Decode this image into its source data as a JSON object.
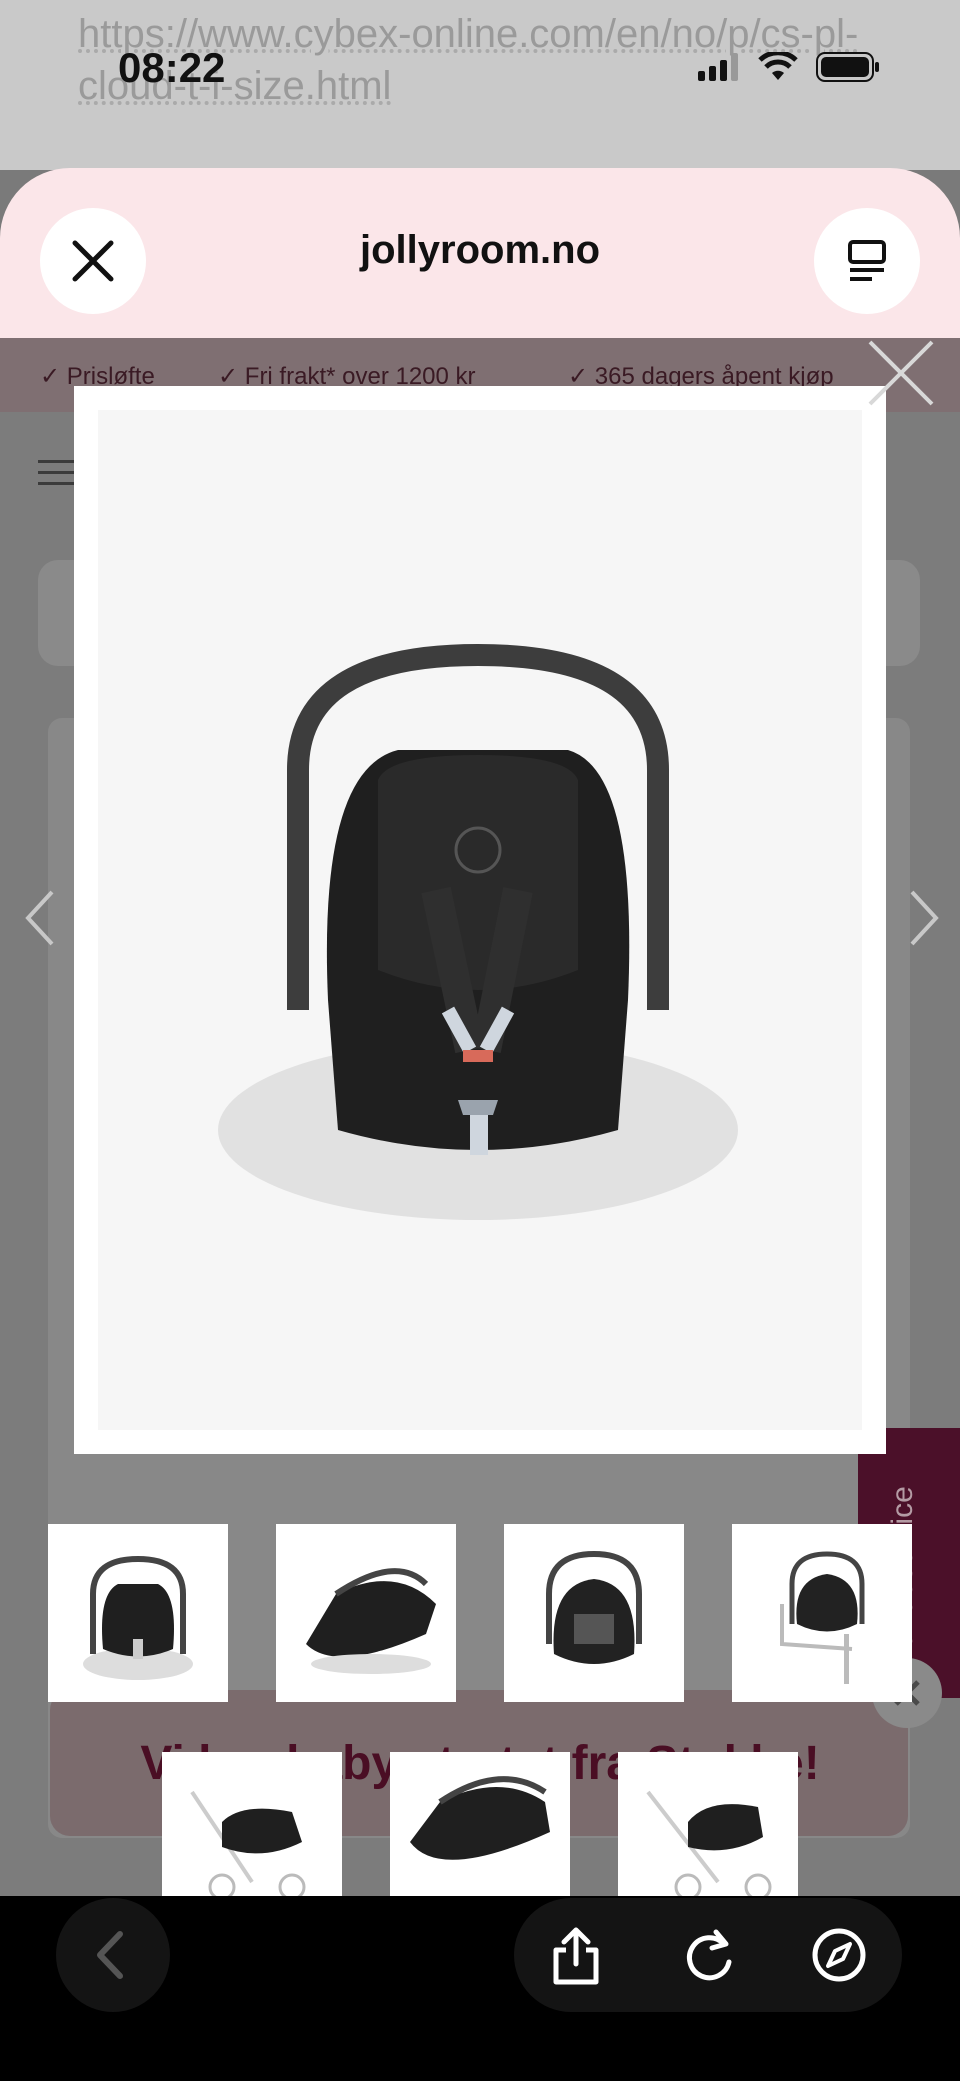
{
  "browser": {
    "url_text": "https://www.cybex-online.com/en/no/p/cs-pl-cloud-t-i-size.html",
    "status_time": "08:22"
  },
  "sheet": {
    "title": "jollyroom.no",
    "close_icon": "close-icon",
    "reader_icon": "reader-icon"
  },
  "usp_bar": {
    "items": [
      "Prisløfte",
      "Fri frakt* over 1200 kr",
      "365 dagers åpent kjøp"
    ]
  },
  "banner": {
    "text": "Vi har baby startet fra Stokke!"
  },
  "side_tab": {
    "label": "Kundeservice"
  },
  "gallery": {
    "thumbnails": [
      "front",
      "side-tilted",
      "back",
      "on-base",
      "on-stroller-side",
      "side",
      "on-stroller-angle"
    ]
  },
  "toolbar": {
    "back_icon": "chevron-left-icon",
    "share_icon": "share-icon",
    "reload_icon": "reload-icon",
    "compass_icon": "compass-icon"
  }
}
